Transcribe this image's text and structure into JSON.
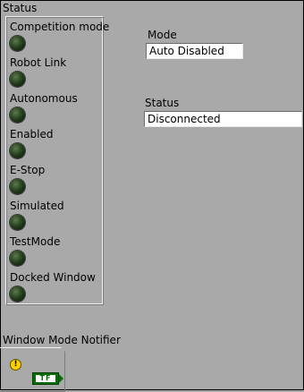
{
  "status_cluster": {
    "title": "Status",
    "indicators": [
      {
        "label": "Competition mode",
        "state": "off"
      },
      {
        "label": "Robot Link",
        "state": "off"
      },
      {
        "label": "Autonomous",
        "state": "off"
      },
      {
        "label": "Enabled",
        "state": "off"
      },
      {
        "label": "E-Stop",
        "state": "off"
      },
      {
        "label": "Simulated",
        "state": "off"
      },
      {
        "label": "TestMode",
        "state": "off"
      },
      {
        "label": "Docked Window",
        "state": "off"
      }
    ]
  },
  "mode": {
    "label": "Mode",
    "value": "Auto Disabled"
  },
  "status": {
    "label": "Status",
    "value": "Disconnected"
  },
  "window_mode_notifier": {
    "label": "Window Mode Notifier",
    "warning_glyph": "!",
    "terminal_text": "TF"
  },
  "colors": {
    "panel": "#a9a9a9",
    "led_off": "#2e4a24",
    "terminal_green": "#0a6b0a",
    "warning": "#ffd000"
  }
}
